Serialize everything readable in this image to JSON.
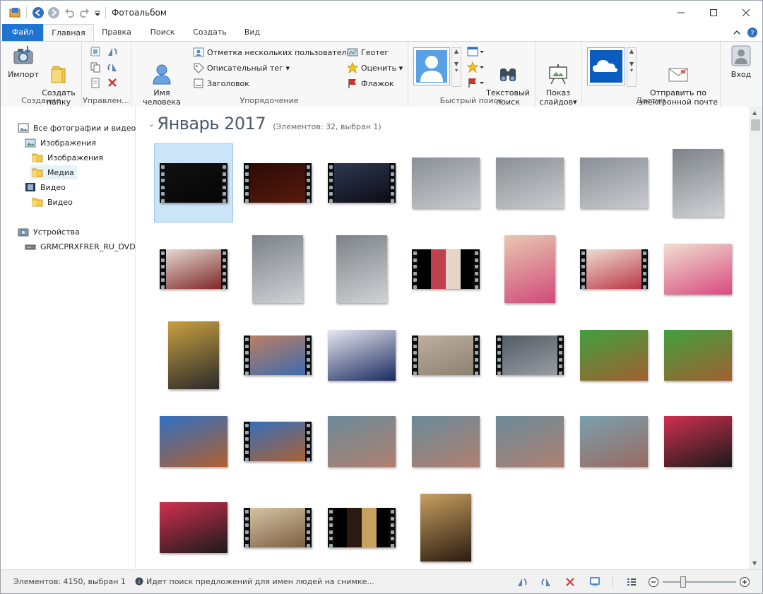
{
  "window": {
    "title": "Фотоальбом"
  },
  "quick_access": {
    "icons": [
      "app-icon",
      "back-icon",
      "forward-icon",
      "undo-icon",
      "redo-icon",
      "customize-icon"
    ]
  },
  "tabs": [
    {
      "label": "Файл"
    },
    {
      "label": "Главная"
    },
    {
      "label": "Правка"
    },
    {
      "label": "Поиск"
    },
    {
      "label": "Создать"
    },
    {
      "label": "Вид"
    }
  ],
  "ribbon": {
    "groups": {
      "create": "Создание",
      "manage": "Управлен...",
      "organize": "Упорядочение",
      "quickfind": "Быстрый поиск",
      "share": "Доступ"
    },
    "import_label": "Импорт",
    "new_folder_label": "Создать\nпапку",
    "person_label": "Имя человека\nна снимке",
    "tag_people": "Отметка нескольких пользователей",
    "desc_tag": "Описательный тег",
    "caption": "Заголовок",
    "geotag": "Геотег",
    "rate": "Оценить",
    "flag": "Флажок",
    "text_search": "Текстовый\nпоиск",
    "slideshow": "Показ\nслайдов",
    "email": "Отправить по\nэлектронной почте",
    "signin": "Вход"
  },
  "nav": {
    "all": "Все фотографии и видео",
    "images": "Изображения",
    "images_sub": "Изображения",
    "media": "Медиа",
    "video": "Видео",
    "video_sub": "Видео",
    "devices": "Устройства",
    "dvd": "GRMCPRXFRER_RU_DVD"
  },
  "content": {
    "group_title": "Январь 2017",
    "group_count": "(Элементов: 32, выбран 1)"
  },
  "status": {
    "items": "Элементов: 4150, выбран 1",
    "message": "Идет поиск предложений для имен людей на снимке..."
  },
  "thumbnails": [
    {
      "kind": "video",
      "style": "black",
      "selected": true
    },
    {
      "kind": "video",
      "style": "darkred"
    },
    {
      "kind": "video",
      "style": "dark-light"
    },
    {
      "kind": "photo",
      "style": "snow"
    },
    {
      "kind": "photo",
      "style": "snow"
    },
    {
      "kind": "photo",
      "style": "snow"
    },
    {
      "kind": "photo",
      "style": "snow-portrait"
    },
    {
      "kind": "video",
      "style": "party"
    },
    {
      "kind": "photo",
      "style": "snow-portrait"
    },
    {
      "kind": "photo",
      "style": "snow-portrait"
    },
    {
      "kind": "video",
      "style": "pillarbox-party"
    },
    {
      "kind": "photo",
      "style": "pink-portrait"
    },
    {
      "kind": "video",
      "style": "party2"
    },
    {
      "kind": "photo",
      "style": "pink"
    },
    {
      "kind": "photo",
      "style": "motherboard"
    },
    {
      "kind": "video",
      "style": "blur"
    },
    {
      "kind": "photo",
      "style": "box"
    },
    {
      "kind": "video",
      "style": "blur2"
    },
    {
      "kind": "video",
      "style": "window"
    },
    {
      "kind": "photo",
      "style": "toys"
    },
    {
      "kind": "photo",
      "style": "toys"
    },
    {
      "kind": "photo",
      "style": "toys2"
    },
    {
      "kind": "video",
      "style": "toys2"
    },
    {
      "kind": "photo",
      "style": "room"
    },
    {
      "kind": "photo",
      "style": "room"
    },
    {
      "kind": "photo",
      "style": "room"
    },
    {
      "kind": "photo",
      "style": "room2"
    },
    {
      "kind": "photo",
      "style": "grill"
    },
    {
      "kind": "photo",
      "style": "grill"
    },
    {
      "kind": "video",
      "style": "table"
    },
    {
      "kind": "video",
      "style": "pillarbox-table"
    },
    {
      "kind": "photo",
      "style": "night-portrait"
    }
  ],
  "colors": {
    "accent": "#1e74cf",
    "selection": "#cce4f7"
  }
}
